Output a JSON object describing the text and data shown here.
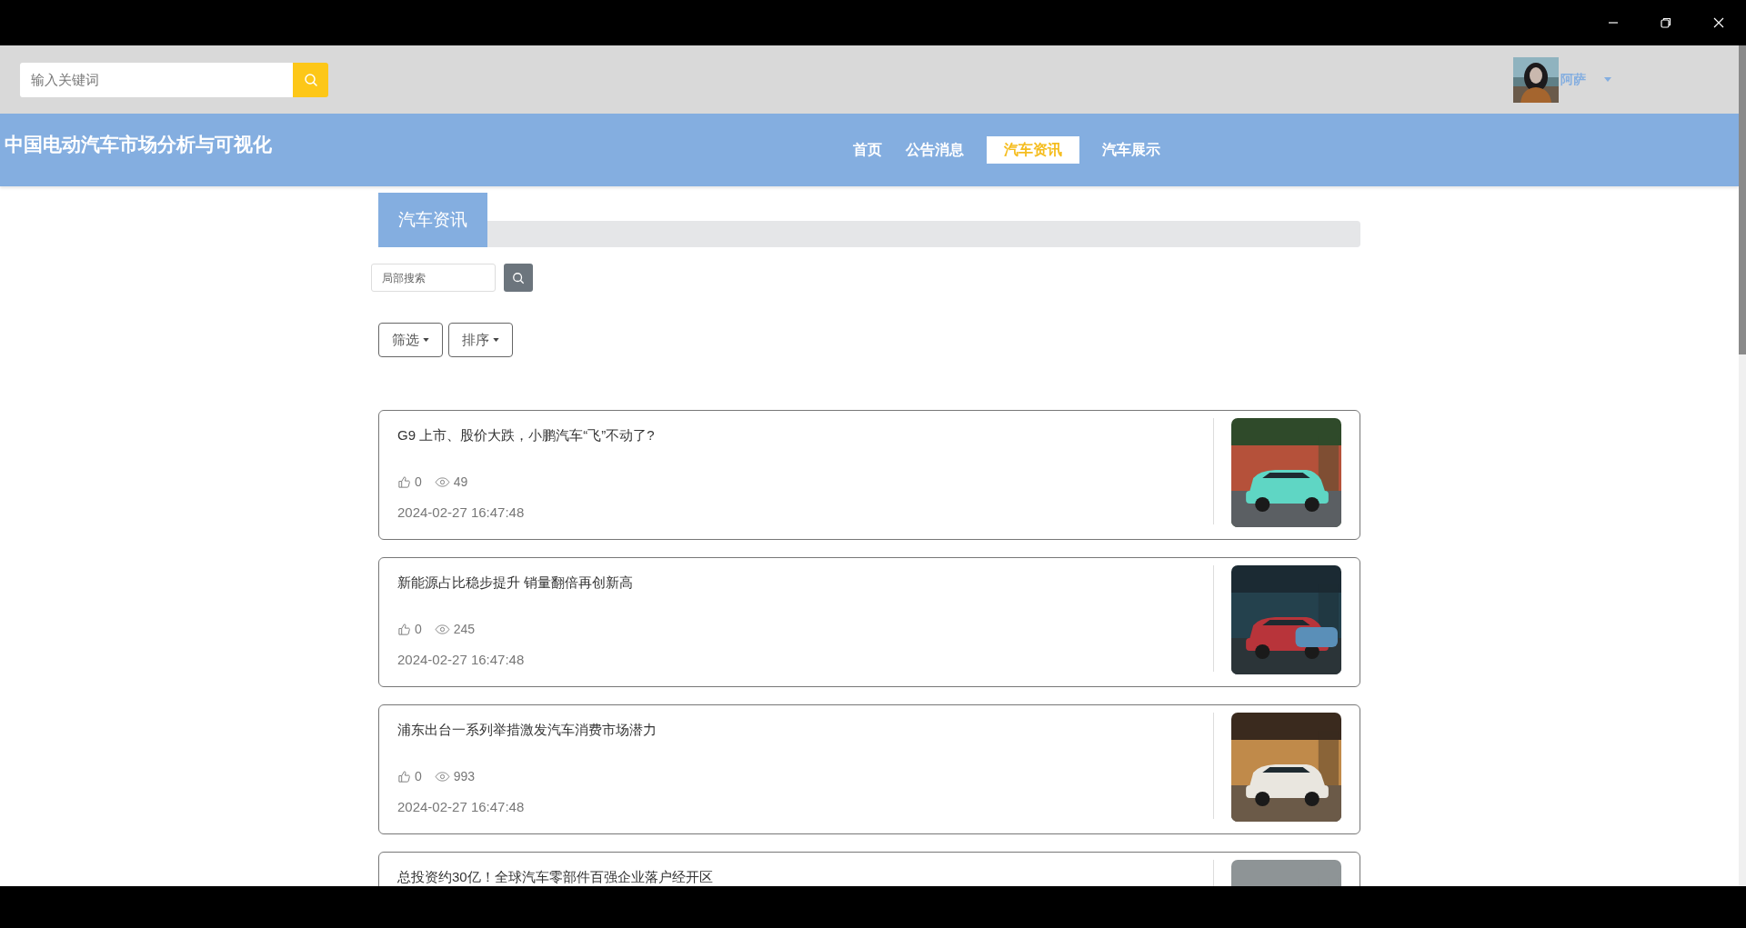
{
  "search": {
    "placeholder": "输入关键词"
  },
  "user": {
    "name": "阿萨"
  },
  "site_title": "中国电动汽车市场分析与可视化",
  "nav": [
    {
      "label": "首页",
      "selected": false
    },
    {
      "label": "公告消息",
      "selected": false
    },
    {
      "label": "汽车资讯",
      "selected": true
    },
    {
      "label": "汽车展示",
      "selected": false
    }
  ],
  "section": {
    "title": "汽车资讯"
  },
  "local_search": {
    "placeholder": "局部搜索"
  },
  "toolbar": [
    {
      "label": "筛选"
    },
    {
      "label": "排序"
    }
  ],
  "articles": [
    {
      "title": "G9 上市、股价大跌，小鹏汽车“飞”不动了?",
      "likes": "0",
      "views": "49",
      "date": "2024-02-27 16:47:48"
    },
    {
      "title": "新能源占比稳步提升 销量翻倍再创新高",
      "likes": "0",
      "views": "245",
      "date": "2024-02-27 16:47:48"
    },
    {
      "title": "浦东出台一系列举措激发汽车消费市场潜力",
      "likes": "0",
      "views": "993",
      "date": "2024-02-27 16:47:48"
    },
    {
      "title": "总投资约30亿！全球汽车零部件百强企业落户经开区"
    }
  ]
}
